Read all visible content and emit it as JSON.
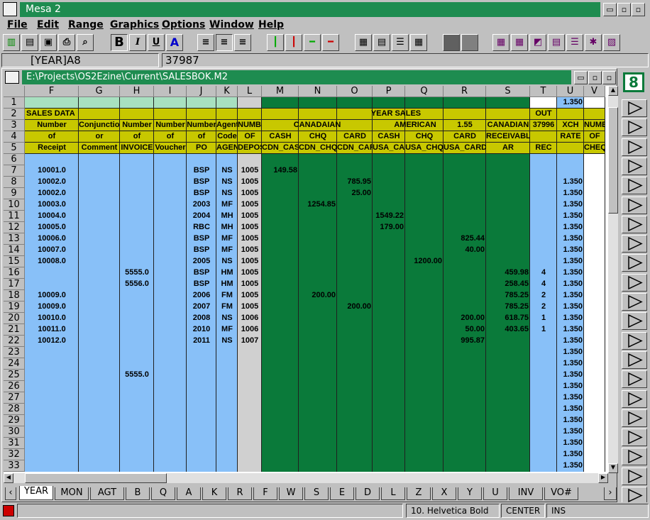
{
  "app": {
    "title": "Mesa 2"
  },
  "menu": [
    "File",
    "Edit",
    "Range",
    "Graphics",
    "Options",
    "Window",
    "Help"
  ],
  "formula": {
    "cell_ref": "[YEAR]A8",
    "value": "37987"
  },
  "document": {
    "path": "E:\\Projects\\OS2Ezine\\Current\\SALESBOK.M2"
  },
  "columns": [
    "F",
    "G",
    "H",
    "I",
    "J",
    "K",
    "L",
    "M",
    "N",
    "O",
    "P",
    "Q",
    "R",
    "S",
    "T",
    "U",
    "V"
  ],
  "rows": [
    "1",
    "2",
    "3",
    "4",
    "5",
    "6",
    "7",
    "8",
    "9",
    "10",
    "11",
    "12",
    "13",
    "14",
    "15",
    "16",
    "17",
    "18",
    "19",
    "20",
    "21",
    "22",
    "23",
    "24",
    "25",
    "26",
    "27",
    "28",
    "29",
    "30",
    "31",
    "32",
    "33"
  ],
  "header_text": {
    "r2_sales": "SALES DATA",
    "r2_year": "YEAR SALES",
    "r2_out": "OUT",
    "r3": [
      "Number",
      "Conjunction",
      "Number",
      "Number",
      "Number",
      "Agent",
      "NUMBER",
      "CANADAIAN",
      "AMERICAN",
      "1.55",
      "CANADIAN",
      "37996",
      "XCH",
      "NUMB"
    ],
    "r4": [
      "of",
      "or",
      "of",
      "of",
      "of",
      "Code",
      "OF",
      "CASH",
      "CHQ",
      "CARD",
      "CASH",
      "CHQ",
      "CARD",
      "RECEIVABLE",
      "RATE",
      "OF"
    ],
    "r5": [
      "Receipt",
      "Comment",
      "INVOICE",
      "Voucher",
      "PO",
      "AGENT",
      "DEPOSIT",
      "CDN_CASH",
      "CDN_CHQ",
      "CDN_CARD",
      "USA_CASH",
      "USA_CHQ",
      "USA_CARD",
      "AR",
      "REC",
      "CHEQ"
    ]
  },
  "data_rows": [
    {
      "r": 7,
      "F": "10001.0",
      "J": "BSP",
      "K": "NS",
      "L": "1005",
      "M": "149.58"
    },
    {
      "r": 8,
      "F": "10002.0",
      "J": "BSP",
      "K": "NS",
      "L": "1005",
      "O": "785.95",
      "U": "1.350"
    },
    {
      "r": 9,
      "F": "10002.0",
      "J": "BSP",
      "K": "NS",
      "L": "1005",
      "O": "25.00",
      "U": "1.350"
    },
    {
      "r": 10,
      "F": "10003.0",
      "J": "2003",
      "K": "MF",
      "L": "1005",
      "N": "1254.85",
      "U": "1.350"
    },
    {
      "r": 11,
      "F": "10004.0",
      "J": "2004",
      "K": "MH",
      "L": "1005",
      "P": "1549.22",
      "U": "1.350"
    },
    {
      "r": 12,
      "F": "10005.0",
      "J": "RBC",
      "K": "MH",
      "L": "1005",
      "P": "179.00",
      "U": "1.350"
    },
    {
      "r": 13,
      "F": "10006.0",
      "J": "BSP",
      "K": "MF",
      "L": "1005",
      "R": "825.44",
      "U": "1.350"
    },
    {
      "r": 14,
      "F": "10007.0",
      "J": "BSP",
      "K": "MF",
      "L": "1005",
      "R": "40.00",
      "U": "1.350"
    },
    {
      "r": 15,
      "F": "10008.0",
      "J": "2005",
      "K": "NS",
      "L": "1005",
      "Q": "1200.00",
      "U": "1.350"
    },
    {
      "r": 16,
      "H": "5555.0",
      "J": "BSP",
      "K": "HM",
      "L": "1005",
      "S": "459.98",
      "T": "4",
      "U": "1.350"
    },
    {
      "r": 17,
      "H": "5556.0",
      "J": "BSP",
      "K": "HM",
      "L": "1005",
      "S": "258.45",
      "T": "4",
      "U": "1.350"
    },
    {
      "r": 18,
      "F": "10009.0",
      "J": "2006",
      "K": "FM",
      "L": "1005",
      "N": "200.00",
      "S": "785.25",
      "T": "2",
      "U": "1.350"
    },
    {
      "r": 19,
      "F": "10009.0",
      "J": "2007",
      "K": "FM",
      "L": "1005",
      "O": "200.00",
      "S": "785.25",
      "T": "2",
      "U": "1.350"
    },
    {
      "r": 20,
      "F": "10010.0",
      "J": "2008",
      "K": "NS",
      "L": "1006",
      "R": "200.00",
      "S": "618.75",
      "T": "1",
      "U": "1.350"
    },
    {
      "r": 21,
      "F": "10011.0",
      "J": "2010",
      "K": "MF",
      "L": "1006",
      "R": "50.00",
      "S": "403.65",
      "T": "1",
      "U": "1.350"
    },
    {
      "r": 22,
      "F": "10012.0",
      "J": "2011",
      "K": "NS",
      "L": "1007",
      "R": "995.87",
      "U": "1.350"
    },
    {
      "r": 23,
      "U": "1.350"
    },
    {
      "r": 24,
      "U": "1.350"
    },
    {
      "r": 25,
      "H": "5555.0",
      "U": "1.350"
    },
    {
      "r": 26,
      "U": "1.350"
    },
    {
      "r": 27,
      "U": "1.350"
    },
    {
      "r": 28,
      "U": "1.350"
    },
    {
      "r": 29,
      "U": "1.350"
    },
    {
      "r": 30,
      "U": "1.350"
    },
    {
      "r": 31,
      "U": "1.350"
    },
    {
      "r": 32,
      "U": "1.350"
    },
    {
      "r": 33,
      "U": "1.350"
    }
  ],
  "row1_U": "1.350",
  "sheet_tabs": [
    "YEAR",
    "MON",
    "AGT",
    "B",
    "Q",
    "A",
    "K",
    "R",
    "F",
    "W",
    "S",
    "E",
    "D",
    "L",
    "Z",
    "X",
    "Y",
    "U",
    "INV",
    "VO#"
  ],
  "status": {
    "font": "10. Helvetica Bold",
    "align": "CENTER",
    "mode": "INS"
  },
  "colors": {
    "green": "#0a7a3a",
    "blue": "#88c0f8",
    "olive": "#c8c800",
    "mint": "#a8e0c0",
    "title": "#1e8c50"
  }
}
